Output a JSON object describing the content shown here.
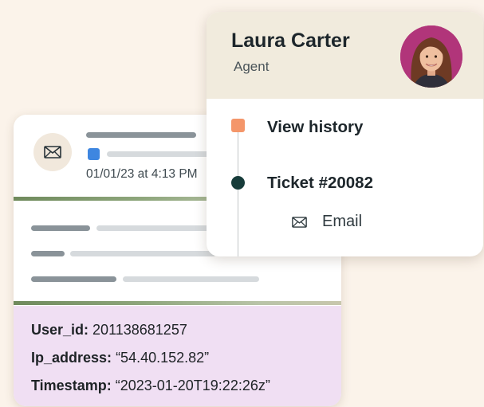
{
  "ticket": {
    "date": "01/01/23 at 4:13 PM",
    "user_id_label": "User_id:",
    "user_id": "201138681257",
    "ip_label": "Ip_address:",
    "ip": "“54.40.152.82”",
    "ts_label": "Timestamp:",
    "ts": "“2023-01-20T19:22:26z”"
  },
  "agent": {
    "name": "Laura Carter",
    "role": "Agent",
    "history_label": "View history",
    "ticket_label": "Ticket #20082",
    "channel_label": "Email"
  },
  "colors": {
    "background": "#fbf3ea",
    "history_marker": "#f4966a",
    "ticket_marker": "#173c3a",
    "info_panel": "#f0dff3",
    "agent_header": "#f1ebdd",
    "blue_marker": "#3e86e0"
  },
  "icons": {
    "ticket_channel": "envelope-icon",
    "email_channel": "envelope-icon"
  }
}
